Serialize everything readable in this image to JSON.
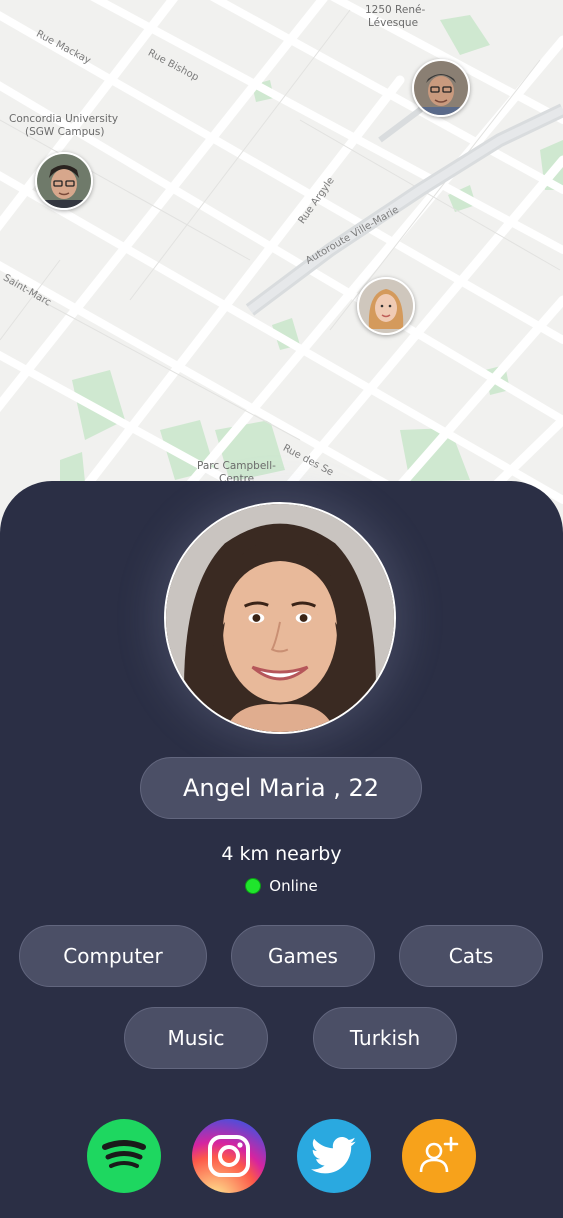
{
  "map": {
    "street_labels": [
      "Rue Mackay",
      "Rue Bishop",
      "Rue Argyle",
      "Autoroute Ville-Marie",
      "Saint-Marc",
      "Rue des Se"
    ],
    "poi_labels": [
      "Concordia University",
      "(SGW Campus)",
      "Parc Campbell-",
      "Centre",
      "1250 René-",
      "Lévesque"
    ],
    "nearby_users": [
      "user-1",
      "user-2",
      "user-3"
    ]
  },
  "profile": {
    "name_age": "Angel Maria , 22",
    "distance": "4 km nearby",
    "status": "Online",
    "status_color": "#1fe52c"
  },
  "interests": [
    "Computer",
    "Games",
    "Cats",
    "Music",
    "Turkish"
  ],
  "social": [
    {
      "name": "spotify-icon",
      "color": "#1ed760"
    },
    {
      "name": "instagram-icon",
      "color": "#d6249f"
    },
    {
      "name": "twitter-icon",
      "color": "#2aa9e0"
    },
    {
      "name": "add-friend-icon",
      "color": "#f7a21b"
    }
  ],
  "colors": {
    "card_background": "#2b2f45",
    "pill_background": "#4b4f66"
  }
}
